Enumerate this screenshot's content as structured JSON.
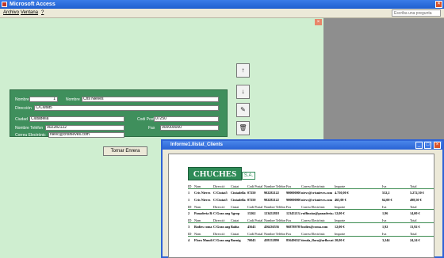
{
  "window": {
    "title": "Microsoft Access",
    "close_label": "×"
  },
  "menu": {
    "items": [
      "Archivo",
      "Ventana",
      "?"
    ],
    "help_placeholder": "Escriba una pregunta"
  },
  "form": {
    "close_label": "×",
    "fields": {
      "nombre_label": "Nombre",
      "nombre_value": "1",
      "nombre2_label": "Nombre",
      "nombre2_value": "Cris Nieves",
      "direccion_label": "Dirección",
      "direccion_value": "C/Ciutat5",
      "ciudad_label": "Ciudad",
      "ciudad_value": "Ciutadella",
      "codpostal_label": "Codi Postal",
      "codpostal_value": "07250",
      "telefono_label": "Nombre Telèfon",
      "telefono_value": "902282122",
      "fax_label": "Fax",
      "fax_value": "900000000",
      "correo_label": "Correu Electrònic",
      "correo_value": "nievc@crisnieves.com"
    },
    "buttons": {
      "up": "↑",
      "down": "↓",
      "edit": "✎",
      "delete": "🗑"
    },
    "tornar_label": "Tornar Enrera"
  },
  "report": {
    "title": "Informe1.llistat_Clients",
    "logo": "CHUCHES",
    "logo_sa": "S.A.",
    "headers": [
      "ID",
      "Nom",
      "Direcció",
      "Ciutat",
      "Codi Postal",
      "Nombre Telèfon",
      "Fax",
      "Correu Electrònic",
      "Importe",
      "Iva",
      "Total"
    ],
    "rows": [
      [
        "1",
        "Cris Nieves",
        "C/Ciutat5",
        "Ciutadella",
        "07250",
        "902282122",
        "900000000",
        "nievc@crisnieves.com",
        "4.750,00 €",
        "532,2",
        "5.272,50 €"
      ],
      [
        "1",
        "Cris Nieves",
        "C/Ciutat5",
        "Ciutadella",
        "07250",
        "902282122",
        "900000000",
        "nievc@crisnieves.com",
        "465,00 €",
        "64,00 €",
        "498,50 €"
      ],
      [
        "2",
        "Panaderia Ruffino",
        "C/Gran angulo",
        "Agrop",
        "15262",
        "123452818",
        "1234521345",
        "ruffinoias@panaderia.org",
        "12,00 €",
        "1,96",
        "14,00 €"
      ],
      [
        "3",
        "Bodies coma",
        "C/Gran angulo",
        "Bahia",
        "45643",
        "456436536",
        "968789789",
        "bodies@coma.com",
        "12,00 €",
        "1,92",
        "13,92 €"
      ],
      [
        "4",
        "Flora Mundi",
        "C/Gran angulo",
        "Buenig",
        "70043",
        "458152890",
        "8564965254",
        "tienda_flora@arflor.nt",
        "20,00 €",
        "3,244",
        "24,24 €"
      ]
    ]
  }
}
